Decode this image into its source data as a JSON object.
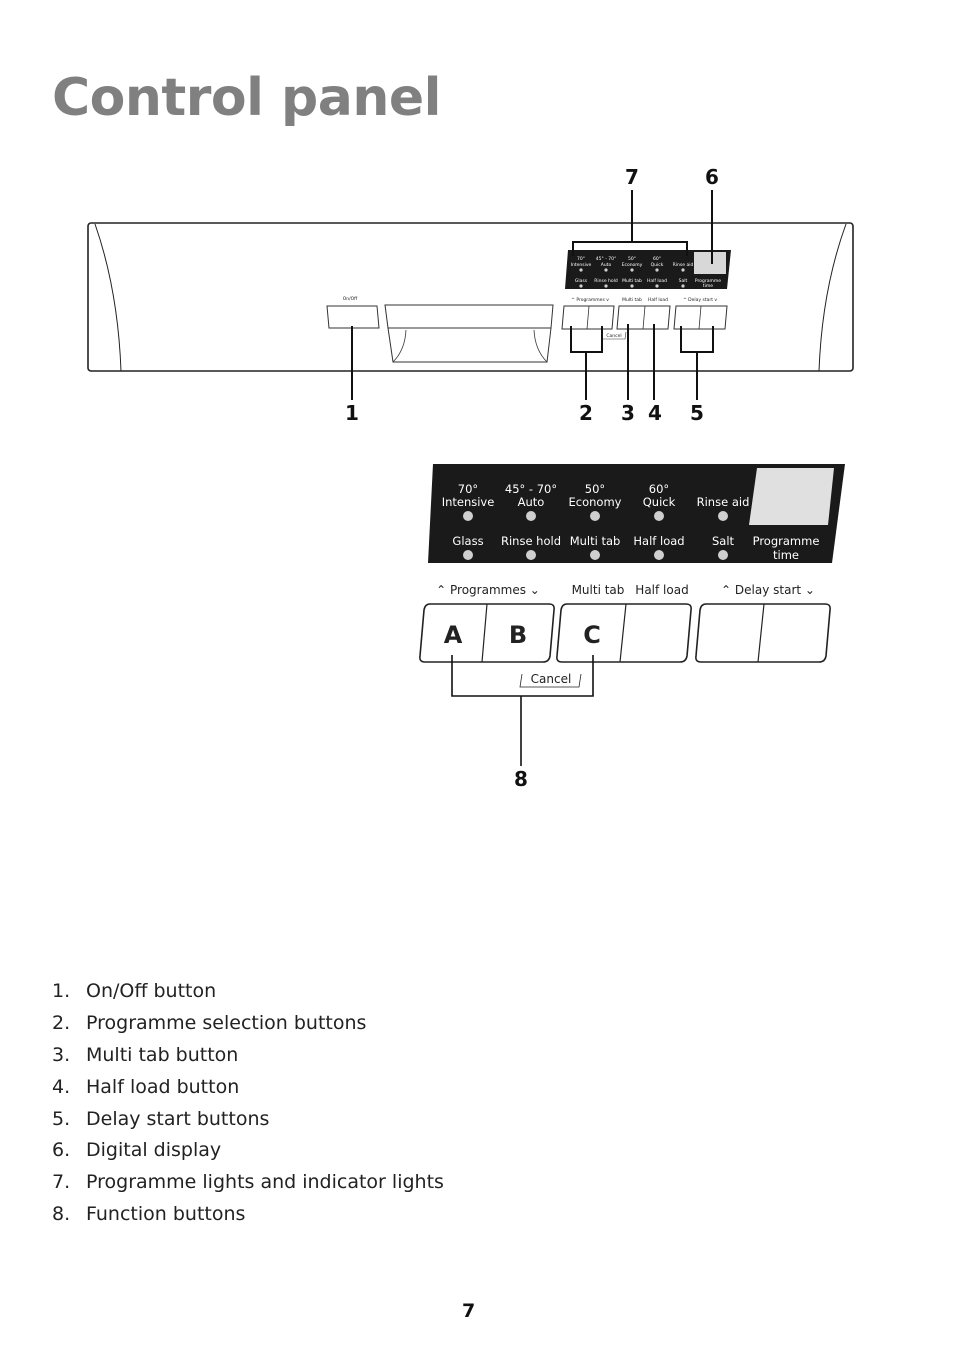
{
  "page": {
    "title": "Control panel",
    "page_number": "7"
  },
  "overview": {
    "callouts": [
      "1",
      "2",
      "3",
      "4",
      "5",
      "6",
      "7"
    ],
    "on_off_label": "On/Off",
    "lights_top": [
      {
        "line1": "70°",
        "line2": "Intensive"
      },
      {
        "line1": "45° - 70°",
        "line2": "Auto"
      },
      {
        "line1": "50°",
        "line2": "Economy"
      },
      {
        "line1": "60°",
        "line2": "Quick"
      },
      {
        "line1": "",
        "line2": "Rinse aid"
      }
    ],
    "lights_bottom": [
      "Glass",
      "Rinse hold",
      "Multi tab",
      "Half load",
      "Salt"
    ],
    "display_label_1": "Programme",
    "display_label_2": "time",
    "button_labels": {
      "programmes": "Programmes",
      "multi_tab": "Multi tab",
      "half_load": "Half load",
      "delay_start": "Delay start"
    },
    "cancel_label": "Cancel"
  },
  "detail": {
    "lights_top": [
      {
        "line1": "70°",
        "line2": "Intensive"
      },
      {
        "line1": "45° - 70°",
        "line2": "Auto"
      },
      {
        "line1": "50°",
        "line2": "Economy"
      },
      {
        "line1": "60°",
        "line2": "Quick"
      },
      {
        "line1": "",
        "line2": "Rinse aid"
      }
    ],
    "lights_bottom": [
      "Glass",
      "Rinse hold",
      "Multi tab",
      "Half load",
      "Salt"
    ],
    "display_label_1": "Programme",
    "display_label_2": "time",
    "button_labels": {
      "programmes": "Programmes",
      "multi_tab": "Multi tab",
      "half_load": "Half load",
      "delay_start": "Delay start"
    },
    "button_letters": [
      "A",
      "B",
      "C"
    ],
    "cancel_label": "Cancel",
    "callout": "8"
  },
  "legend": [
    {
      "num": "1.",
      "text": "On/Off button"
    },
    {
      "num": "2.",
      "text": "Programme selection buttons"
    },
    {
      "num": "3.",
      "text": "Multi tab button"
    },
    {
      "num": "4.",
      "text": "Half load button"
    },
    {
      "num": "5.",
      "text": "Delay start buttons"
    },
    {
      "num": "6.",
      "text": "Digital display"
    },
    {
      "num": "7.",
      "text": "Programme lights and indicator lights"
    },
    {
      "num": "8.",
      "text": "Function buttons"
    }
  ]
}
